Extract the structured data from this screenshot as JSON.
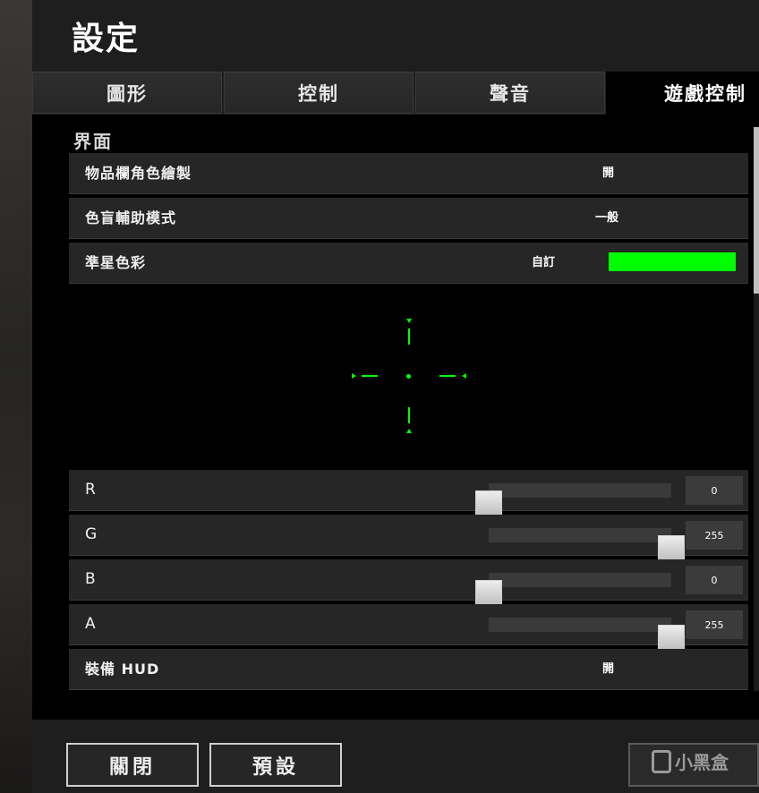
{
  "header": {
    "title": "設定"
  },
  "tabs": [
    {
      "label": "圖形",
      "active": false
    },
    {
      "label": "控制",
      "active": false
    },
    {
      "label": "聲音",
      "active": false
    },
    {
      "label": "遊戲控制",
      "active": true
    }
  ],
  "section": {
    "title": "界面"
  },
  "settings": {
    "inventory_color": {
      "label": "物品欄角色繪製",
      "value": "開"
    },
    "colorblind": {
      "label": "色盲輔助模式",
      "value": "一般"
    },
    "crosshair_color": {
      "label": "準星色彩",
      "value": "自訂",
      "swatch": "#00ff00"
    },
    "equip_hud": {
      "label": "裝備 HUD",
      "value": "開"
    }
  },
  "sliders": [
    {
      "label": "R",
      "value": "0",
      "fraction": 0.0
    },
    {
      "label": "G",
      "value": "255",
      "fraction": 1.0
    },
    {
      "label": "B",
      "value": "0",
      "fraction": 0.0
    },
    {
      "label": "A",
      "value": "255",
      "fraction": 1.0
    }
  ],
  "footer": {
    "close_label": "關閉",
    "default_label": "預設"
  },
  "watermark": {
    "text": "小黑盒"
  },
  "colors": {
    "crosshair": "#00ff00",
    "panel": "#1e1e1e",
    "content": "#000000"
  }
}
